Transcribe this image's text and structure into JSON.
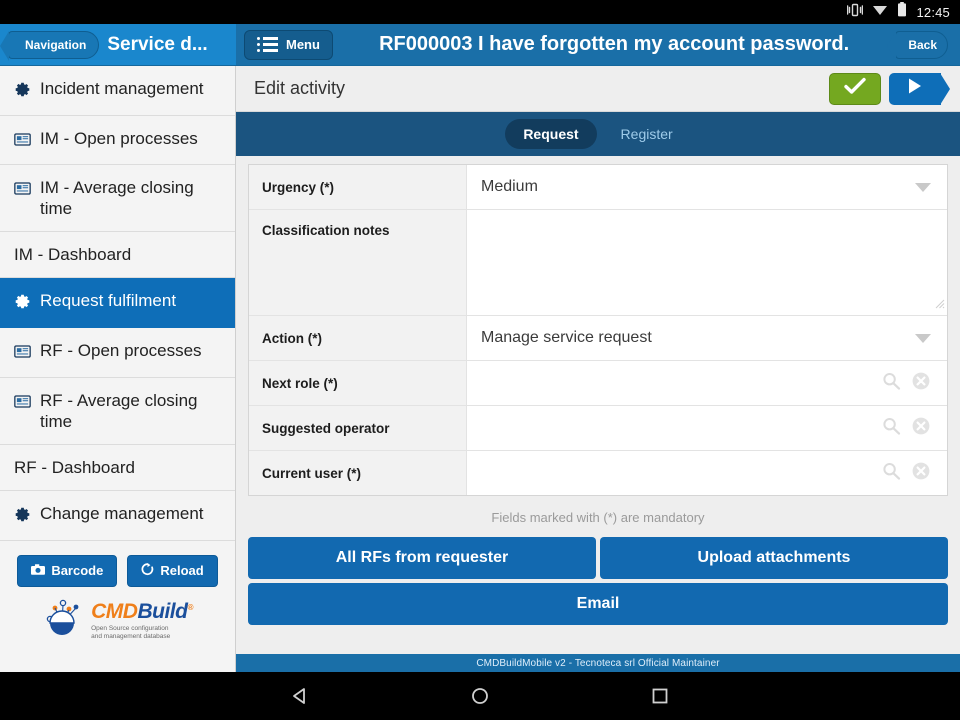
{
  "statusbar": {
    "time": "12:45",
    "icons": [
      "vibrate-icon",
      "wifi-icon",
      "battery-icon"
    ]
  },
  "header": {
    "nav_button": "Navigation",
    "app_title": "Service d...",
    "menu_button": "Menu",
    "record_title": "RF000003 I have forgotten my account password.",
    "back_button": "Back"
  },
  "sidebar": {
    "items": [
      {
        "label": "Incident management",
        "icon": "gear-icon",
        "active": false
      },
      {
        "label": "IM - Open processes",
        "icon": "report-icon",
        "active": false
      },
      {
        "label": "IM - Average closing time",
        "icon": "report-icon",
        "active": false
      },
      {
        "label": "IM - Dashboard",
        "icon": "none",
        "active": false
      },
      {
        "label": "Request fulfilment",
        "icon": "gear-icon",
        "active": true
      },
      {
        "label": "RF - Open processes",
        "icon": "report-icon",
        "active": false
      },
      {
        "label": "RF - Average closing time",
        "icon": "report-icon",
        "active": false
      },
      {
        "label": "RF - Dashboard",
        "icon": "none",
        "active": false
      },
      {
        "label": "Change management",
        "icon": "gear-icon",
        "active": false
      }
    ],
    "barcode_button": "Barcode",
    "reload_button": "Reload",
    "logo": {
      "part1": "CMD",
      "part2": "Build",
      "registered": "®",
      "tagline_line1": "Open Source configuration",
      "tagline_line2": "and management database"
    }
  },
  "subbar": {
    "title": "Edit activity",
    "confirm_icon": "check-icon",
    "advance_icon": "play-icon"
  },
  "tabs": [
    {
      "label": "Request",
      "active": true
    },
    {
      "label": "Register",
      "active": false
    }
  ],
  "form": {
    "fields": [
      {
        "label": "Urgency (*)",
        "value": "Medium",
        "type": "select"
      },
      {
        "label": "Classification notes",
        "value": "",
        "type": "textarea"
      },
      {
        "label": "Action (*)",
        "value": "Manage service request",
        "type": "select"
      },
      {
        "label": "Next role (*)",
        "value": "",
        "type": "lookup"
      },
      {
        "label": "Suggested operator",
        "value": "",
        "type": "lookup"
      },
      {
        "label": "Current user (*)",
        "value": "",
        "type": "lookup"
      }
    ],
    "mandatory_note": "Fields marked with (*) are mandatory"
  },
  "actions": {
    "all_rfs": "All RFs from requester",
    "upload": "Upload attachments",
    "email": "Email"
  },
  "footer": {
    "text": "CMDBuildMobile v2 - Tecnoteca srl Official Maintainer"
  },
  "navbar": {
    "back": "back-triangle-icon",
    "home": "home-circle-icon",
    "recents": "recents-square-icon"
  },
  "colors": {
    "brand_blue": "#1a6fa8",
    "light_blue": "#1a87cd",
    "accent_blue": "#0e6eb8",
    "tab_navy": "#1b5480",
    "confirm_green": "#74a820",
    "logo_orange": "#ef7f1a",
    "logo_blue": "#1b4f9c"
  }
}
